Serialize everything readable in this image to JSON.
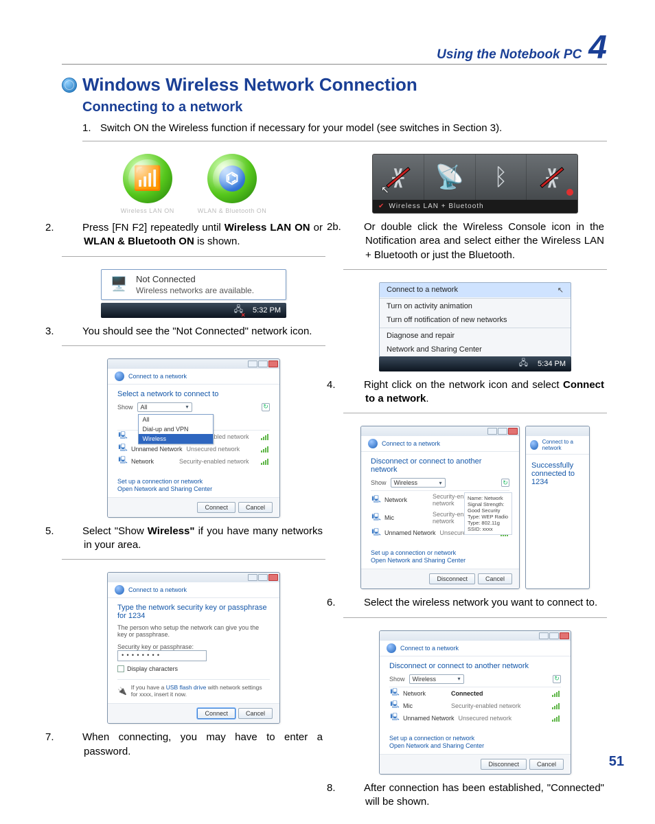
{
  "header": {
    "section": "Using the Notebook PC",
    "chapter": "4"
  },
  "title": "Windows Wireless Network Connection",
  "subtitle": "Connecting to a network",
  "page_number": "51",
  "steps": {
    "s1": {
      "num": "1.",
      "text": "Switch ON the Wireless function if necessary for your model (see switches in Section 3)."
    },
    "s2": {
      "num": "2.",
      "pre": "Press [FN F2] repeatedly until ",
      "b1": "Wireless LAN ON",
      "mid": " or ",
      "b2": "WLAN & Bluetooth ON",
      "post": " is shown."
    },
    "s2b": {
      "num": "2b.",
      "text": "Or double click the Wireless Console icon in the Notification area and select either the Wireless LAN + Bluetooth or just the Bluetooth."
    },
    "s3": {
      "num": "3.",
      "text": "You should see the \"Not Connected\" network icon."
    },
    "s4": {
      "num": "4.",
      "pre": "Right click on the network icon and select ",
      "b1": "Connect to a network",
      "post": "."
    },
    "s5": {
      "num": "5.",
      "pre": "Select \"Show ",
      "b1": "Wireless\"",
      "post": " if you have many networks in your area."
    },
    "s6": {
      "num": "6.",
      "text": "Select the wireless network you want to connect to."
    },
    "s7": {
      "num": "7.",
      "text": "When connecting, you may have to enter a password."
    },
    "s8": {
      "num": "8.",
      "text": "After connection has been established, \"Connected\" will be shown."
    }
  },
  "fig_icons": {
    "cap1": "Wireless LAN ON",
    "cap2": "WLAN & Bluetooth ON",
    "strip_label": "Wireless LAN + Bluetooth"
  },
  "fig_tooltip": {
    "title": "Not Connected",
    "sub": "Wireless networks are available.",
    "time": "5:32 PM"
  },
  "fig_ctx": {
    "i1": "Connect to a network",
    "i2": "Turn on activity animation",
    "i3": "Turn off notification of new networks",
    "i4": "Diagnose and repair",
    "i5": "Network and Sharing Center",
    "time": "5:34 PM"
  },
  "dlg_common": {
    "win_title": "Connect to a network",
    "show": "Show",
    "links1": "Set up a connection or network",
    "links2": "Open Network and Sharing Center",
    "connect": "Connect",
    "cancel": "Cancel",
    "disconnect": "Disconnect"
  },
  "dlg5": {
    "heading": "Select a network to connect to",
    "sel": "All",
    "dd1": "All",
    "dd2": "Dial-up and VPN",
    "dd3": "Wireless",
    "row1_name": "  ",
    "row1_type": "Security-enabled network",
    "row2_name": "Unnamed Network",
    "row2_type": "Unsecured network",
    "row3_name": "Network",
    "row3_type": "Security-enabled network"
  },
  "dlg6": {
    "heading": "Disconnect or connect to another network",
    "sel": "Wireless",
    "row1_name": "Network",
    "row1_type": "Security-enabled network",
    "row2_name": "Mic",
    "row2_type": "Security-enabled network",
    "row3_name": "Unnamed Network",
    "row3_type": "Unsecured network",
    "tooltip": "Name: Network\nSignal Strength: Good\nSecurity Type: WEP\nRadio Type: 802.11g\nSSID: xxxx",
    "callout": "Successfully connected to 1234"
  },
  "dlg7": {
    "heading": "Type the network security key or passphrase for 1234",
    "sub": "The person who setup the network can give you the key or passphrase.",
    "label": "Security key or passphrase:",
    "value": "••••••••",
    "chk": "Display characters",
    "usb": "If you have a USB flash drive with network settings for xxxx, insert it now.",
    "usb_link": "USB flash drive"
  },
  "dlg8": {
    "heading": "Disconnect or connect to another network",
    "sel": "Wireless",
    "row1_name": "Network",
    "row1_type": "Connected",
    "row2_name": "Mic",
    "row2_type": "Security-enabled network",
    "row3_name": "Unnamed Network",
    "row3_type": "Unsecured network"
  }
}
